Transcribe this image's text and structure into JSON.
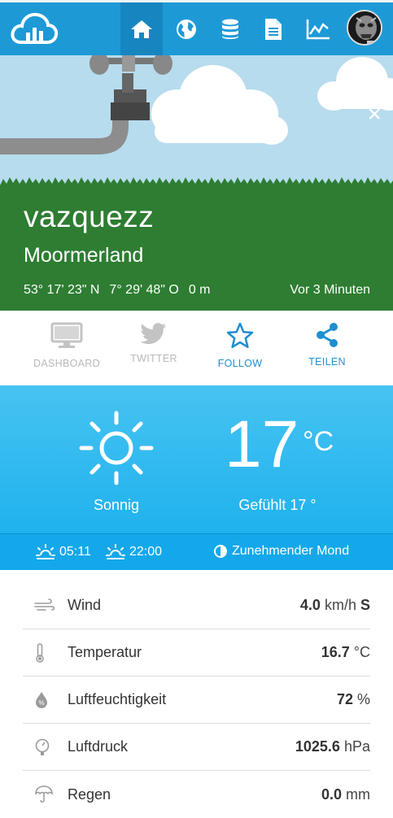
{
  "nav": {
    "items": [
      {
        "icon": "home-icon",
        "active": true
      },
      {
        "icon": "globe-icon",
        "active": false
      },
      {
        "icon": "database-icon",
        "active": false
      },
      {
        "icon": "document-icon",
        "active": false
      },
      {
        "icon": "chart-icon",
        "active": false
      }
    ],
    "logo": "cloud-bars-logo",
    "avatar": "user-avatar"
  },
  "hero": {
    "station_name": "vazquezz",
    "location": "Moormerland",
    "latitude": "53° 17' 23\" N",
    "longitude": "7° 29' 48\" O",
    "altitude": "0 m",
    "updated": "Vor 3 Minuten",
    "close_symbol": "×"
  },
  "actions": [
    {
      "label": "DASHBOARD",
      "icon": "monitor-icon",
      "state": "muted"
    },
    {
      "label": "TWITTER",
      "icon": "twitter-icon",
      "state": "muted"
    },
    {
      "label": "FOLLOW",
      "icon": "star-icon",
      "state": "active"
    },
    {
      "label": "TEILEN",
      "icon": "share-icon",
      "state": "active"
    }
  ],
  "weather": {
    "temperature": "17",
    "unit": "°C",
    "condition": "Sonnig",
    "feels_like": "Gefühlt 17 °",
    "sunrise": "05:11",
    "sunset": "22:00",
    "moon_phase": "Zunehmender Mond"
  },
  "measurements": [
    {
      "name": "Wind",
      "value": "4.0",
      "unit": "km/h",
      "extra": "S",
      "icon": "wind-icon"
    },
    {
      "name": "Temperatur",
      "value": "16.7",
      "unit": "°C",
      "extra": "",
      "icon": "thermometer-icon"
    },
    {
      "name": "Luftfeuchtigkeit",
      "value": "72",
      "unit": "%",
      "extra": "",
      "icon": "humidity-icon"
    },
    {
      "name": "Luftdruck",
      "value": "1025.6",
      "unit": "hPa",
      "extra": "",
      "icon": "barometer-icon"
    },
    {
      "name": "Regen",
      "value": "0.0",
      "unit": "mm",
      "extra": "",
      "icon": "umbrella-icon"
    }
  ],
  "colors": {
    "header": "#1d9ad6",
    "grass": "#2e7d32",
    "sky": "#b7dcee",
    "weather_panel": "#33bdf0",
    "accent": "#1d8fd0"
  }
}
